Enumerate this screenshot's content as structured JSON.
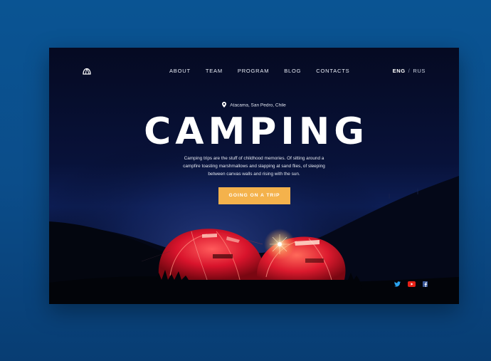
{
  "header": {
    "logo_icon": "tent-dome-icon",
    "nav": [
      {
        "label": "ABOUT"
      },
      {
        "label": "TEAM"
      },
      {
        "label": "PROGRAM"
      },
      {
        "label": "BLOG"
      },
      {
        "label": "CONTACTS"
      }
    ],
    "language": {
      "active": "ENG",
      "separator": "/",
      "other": "RUS"
    }
  },
  "hero": {
    "location_icon": "map-pin-icon",
    "location": "Atacama, San Pedro, Chile",
    "title": "CAMPING",
    "description": "Camping trips are the stuff of childhood memories. Of sitting around a campfire toasting marshmallows and slapping at sand flies, of sleeping between canvas walls and rising with the sun.",
    "cta_label": "GOING ON A TRIP"
  },
  "social": [
    {
      "icon": "twitter-icon"
    },
    {
      "icon": "youtube-icon"
    },
    {
      "icon": "facebook-icon"
    }
  ],
  "colors": {
    "page_background": "#0b4f8d",
    "card_background": "#060c28",
    "accent": "#f4b24c",
    "tent": "#d9142c",
    "text": "#ffffff"
  }
}
